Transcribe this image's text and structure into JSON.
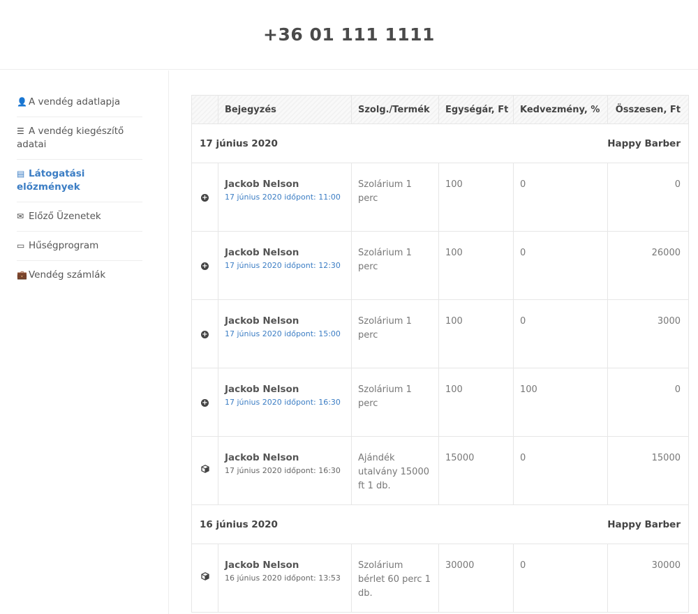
{
  "header": {
    "phone": "+36 01 111 1111"
  },
  "sidebar": {
    "items": [
      {
        "icon": "user-icon",
        "glyph": "👤",
        "label": "A vendég adatlapja",
        "active": false
      },
      {
        "icon": "list-icon",
        "glyph": "☰",
        "label": "A vendég kiegészítő adatai",
        "active": false
      },
      {
        "icon": "table-icon",
        "glyph": "▤",
        "label": "Látogatási előzmények",
        "active": true
      },
      {
        "icon": "envelope-icon",
        "glyph": "✉",
        "label": "Előző Üzenetek",
        "active": false
      },
      {
        "icon": "credit-card-icon",
        "glyph": "▭",
        "label": "Hűségprogram",
        "active": false
      },
      {
        "icon": "briefcase-icon",
        "glyph": "💼",
        "label": "Vendég számlák",
        "active": false
      }
    ]
  },
  "table": {
    "columns": {
      "entry": "Bejegyzés",
      "product": "Szolg./Termék",
      "unit_price": "Egységár, Ft",
      "discount": "Kedvezmény, %",
      "total": "Összesen, Ft"
    },
    "groups": [
      {
        "date": "17 június 2020",
        "salon": "Happy Barber",
        "rows": [
          {
            "icon": "plus-circle-icon",
            "name": "Jackob Nelson",
            "appt": "17 június 2020 időpont: 11:00",
            "appt_link": true,
            "product": "Szolárium 1 perc",
            "unit_price": "100",
            "discount": "0",
            "total": "0"
          },
          {
            "icon": "plus-circle-icon",
            "name": "Jackob Nelson",
            "appt": "17 június 2020 időpont: 12:30",
            "appt_link": true,
            "product": "Szolárium 1 perc",
            "unit_price": "100",
            "discount": "0",
            "total": "26000"
          },
          {
            "icon": "plus-circle-icon",
            "name": "Jackob Nelson",
            "appt": "17 június 2020 időpont: 15:00",
            "appt_link": true,
            "product": "Szolárium 1 perc",
            "unit_price": "100",
            "discount": "0",
            "total": "3000"
          },
          {
            "icon": "plus-circle-icon",
            "name": "Jackob Nelson",
            "appt": "17 június 2020 időpont: 16:30",
            "appt_link": true,
            "product": "Szolárium 1 perc",
            "unit_price": "100",
            "discount": "100",
            "total": "0"
          },
          {
            "icon": "cube-icon",
            "name": "Jackob Nelson",
            "appt": "17 június 2020 időpont: 16:30",
            "appt_link": false,
            "product": "Ajándék utalvány 15000 ft 1 db.",
            "unit_price": "15000",
            "discount": "0",
            "total": "15000"
          }
        ]
      },
      {
        "date": "16 június 2020",
        "salon": "Happy Barber",
        "rows": [
          {
            "icon": "cube-icon",
            "name": "Jackob Nelson",
            "appt": "16 június 2020 időpont: 13:53",
            "appt_link": false,
            "product": "Szolárium bérlet 60 perc 1 db.",
            "unit_price": "30000",
            "discount": "0",
            "total": "30000"
          }
        ]
      }
    ]
  }
}
